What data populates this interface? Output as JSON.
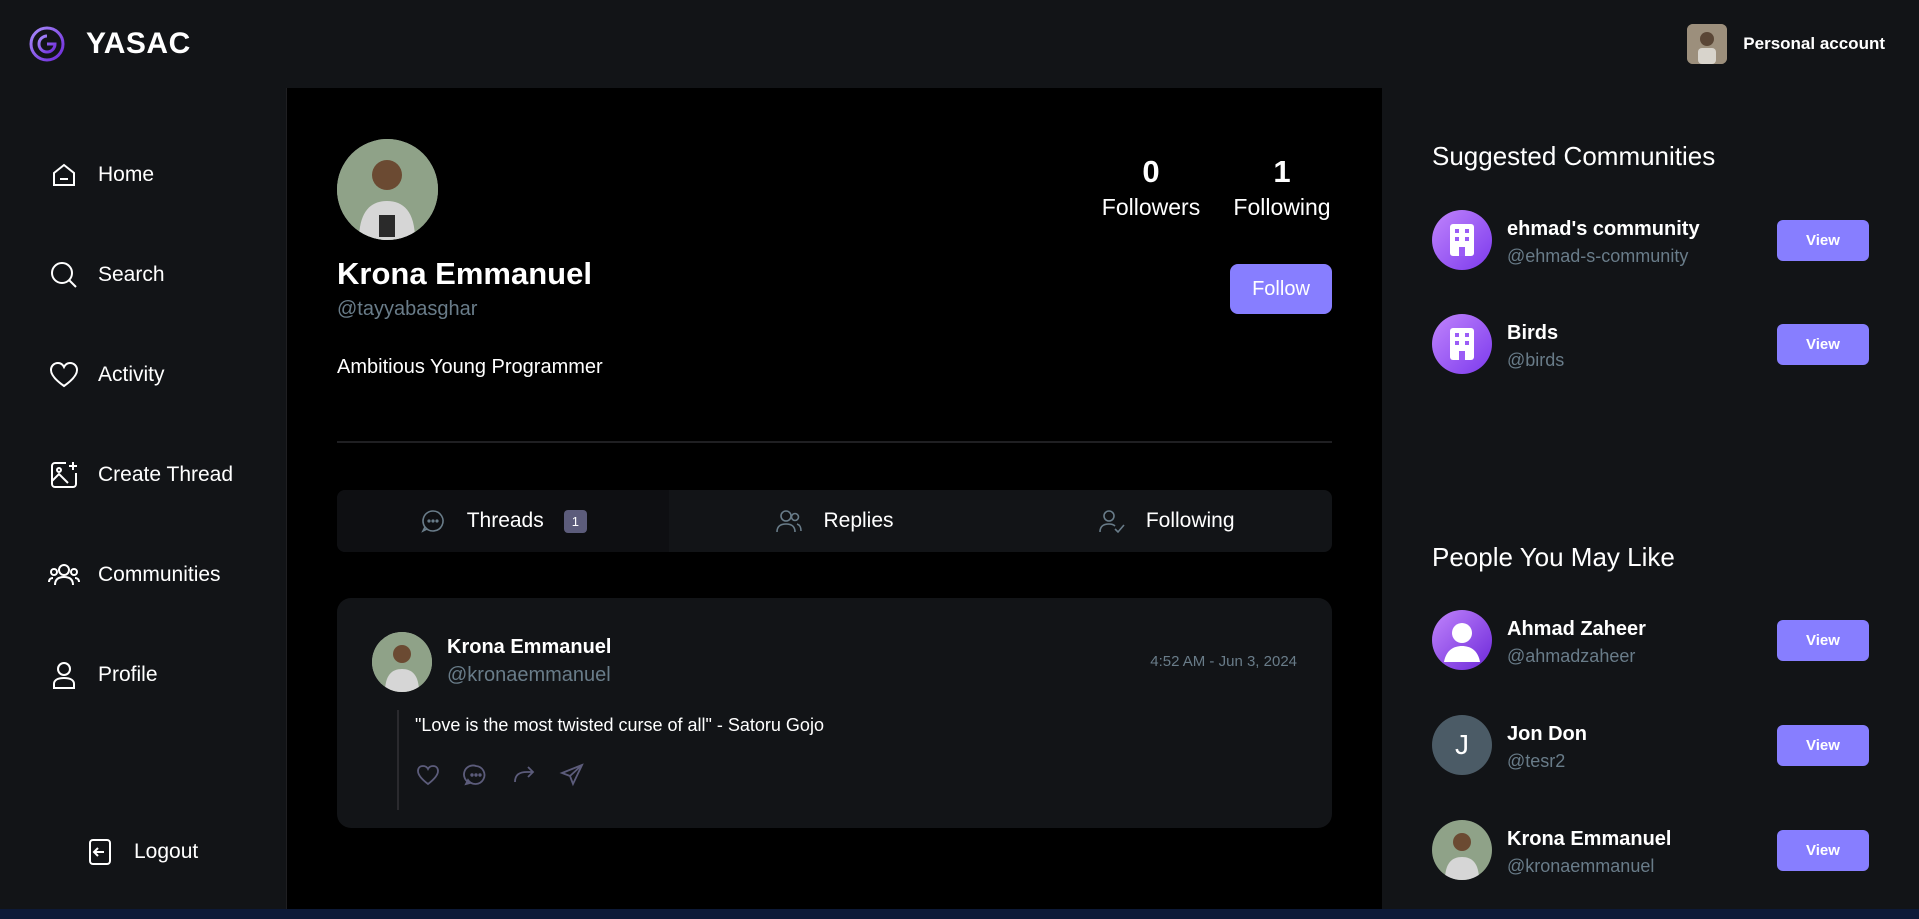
{
  "brand": {
    "name": "YASAC"
  },
  "account": {
    "label": "Personal account"
  },
  "nav": {
    "items": [
      {
        "label": "Home",
        "icon": "home-icon"
      },
      {
        "label": "Search",
        "icon": "search-icon"
      },
      {
        "label": "Activity",
        "icon": "heart-icon"
      },
      {
        "label": "Create Thread",
        "icon": "image-plus-icon"
      },
      {
        "label": "Communities",
        "icon": "users-icon"
      },
      {
        "label": "Profile",
        "icon": "user-icon"
      }
    ],
    "logout": "Logout"
  },
  "profile": {
    "name": "Krona Emmanuel",
    "handle": "@tayyabasghar",
    "bio": "Ambitious Young Programmer",
    "followers_count": "0",
    "followers_label": "Followers",
    "following_count": "1",
    "following_label": "Following",
    "follow_button": "Follow"
  },
  "tabs": [
    {
      "label": "Threads",
      "badge": "1",
      "icon": "message-icon"
    },
    {
      "label": "Replies",
      "icon": "users-icon"
    },
    {
      "label": "Following",
      "icon": "user-check-icon"
    }
  ],
  "thread": {
    "author": "Krona Emmanuel",
    "handle": "@kronaemmanuel",
    "time": "4:52 AM - Jun 3, 2024",
    "text": "\"Love is the most twisted curse of all\" - Satoru Gojo"
  },
  "suggested_communities": {
    "title": "Suggested Communities",
    "items": [
      {
        "name": "ehmad's community",
        "handle": "@ehmad-s-community",
        "button": "View"
      },
      {
        "name": "Birds",
        "handle": "@birds",
        "button": "View"
      }
    ]
  },
  "people": {
    "title": "People You May Like",
    "items": [
      {
        "name": "Ahmad Zaheer",
        "handle": "@ahmadzaheer",
        "button": "View"
      },
      {
        "name": "Jon Don",
        "handle": "@tesr2",
        "button": "View",
        "initial": "J"
      },
      {
        "name": "Krona Emmanuel",
        "handle": "@kronaemmanuel",
        "button": "View"
      }
    ]
  },
  "colors": {
    "accent": "#877eff",
    "muted": "#697c89",
    "panel": "#121417",
    "main_bg": "#000000"
  }
}
